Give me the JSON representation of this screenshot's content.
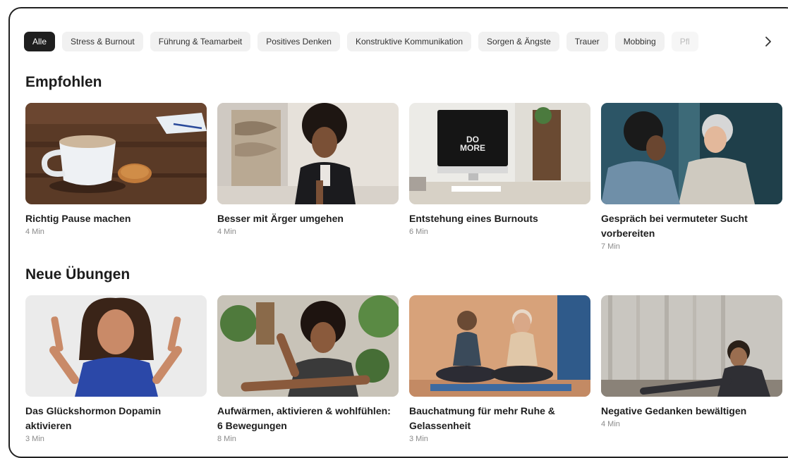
{
  "filters": [
    {
      "label": "Alle",
      "active": true
    },
    {
      "label": "Stress & Burnout"
    },
    {
      "label": "Führung & Teamarbeit"
    },
    {
      "label": "Positives Denken"
    },
    {
      "label": "Konstruktive Kommunikation"
    },
    {
      "label": "Sorgen & Ängste"
    },
    {
      "label": "Trauer"
    },
    {
      "label": "Mobbing"
    },
    {
      "label": "Pfl"
    }
  ],
  "recommended": {
    "title": "Empfohlen",
    "cards": [
      {
        "title": "Richtig Pause machen",
        "duration": "4 Min"
      },
      {
        "title": "Besser mit Ärger umgehen",
        "duration": "4 Min"
      },
      {
        "title": "Entstehung eines Burnouts",
        "duration": "6 Min",
        "screen_text": "DO MORE"
      },
      {
        "title": "Gespräch bei vermuteter Sucht vorbereiten",
        "duration": "7 Min"
      }
    ]
  },
  "new_exercises": {
    "title": "Neue Übungen",
    "cards": [
      {
        "title": "Das Glückshormon Dopamin aktivieren",
        "duration": "3 Min"
      },
      {
        "title": "Aufwärmen, aktivieren & wohlfühlen: 6 Bewegungen",
        "duration": "8 Min"
      },
      {
        "title": "Bauchatmung für mehr Ruhe & Gelassenheit",
        "duration": "3 Min"
      },
      {
        "title": "Negative Gedanken bewältigen",
        "duration": "4 Min"
      }
    ]
  }
}
